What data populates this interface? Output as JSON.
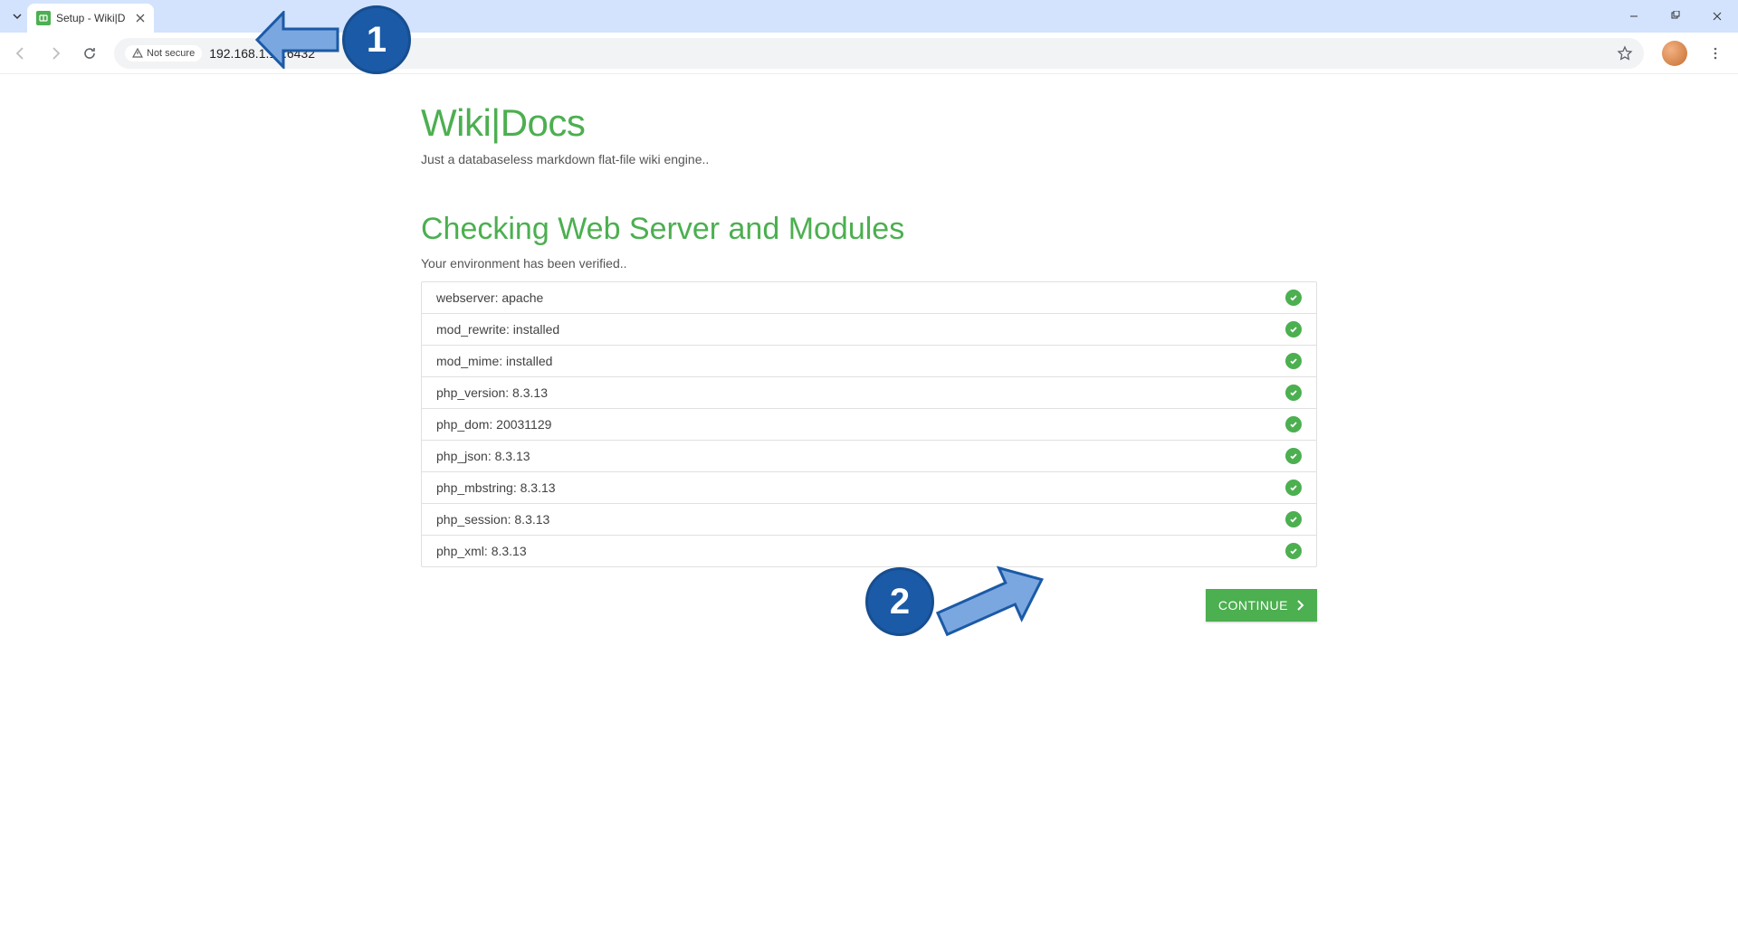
{
  "browser": {
    "tab_title": "Setup - Wiki|D",
    "not_secure_label": "Not secure",
    "url": "192.168.1.18:6432"
  },
  "page": {
    "brand": "Wiki|Docs",
    "tagline": "Just a databaseless markdown flat-file wiki engine..",
    "section_title": "Checking Web Server and Modules",
    "section_sub": "Your environment has been verified..",
    "checks": [
      {
        "label": "webserver: apache",
        "status": "ok"
      },
      {
        "label": "mod_rewrite: installed",
        "status": "ok"
      },
      {
        "label": "mod_mime: installed",
        "status": "ok"
      },
      {
        "label": "php_version: 8.3.13",
        "status": "ok"
      },
      {
        "label": "php_dom: 20031129",
        "status": "ok"
      },
      {
        "label": "php_json: 8.3.13",
        "status": "ok"
      },
      {
        "label": "php_mbstring: 8.3.13",
        "status": "ok"
      },
      {
        "label": "php_session: 8.3.13",
        "status": "ok"
      },
      {
        "label": "php_xml: 8.3.13",
        "status": "ok"
      }
    ],
    "continue_label": "CONTINUE"
  },
  "annotations": {
    "step1": "1",
    "step2": "2"
  },
  "colors": {
    "accent": "#4caf50",
    "badge": "#1b5aa6"
  }
}
